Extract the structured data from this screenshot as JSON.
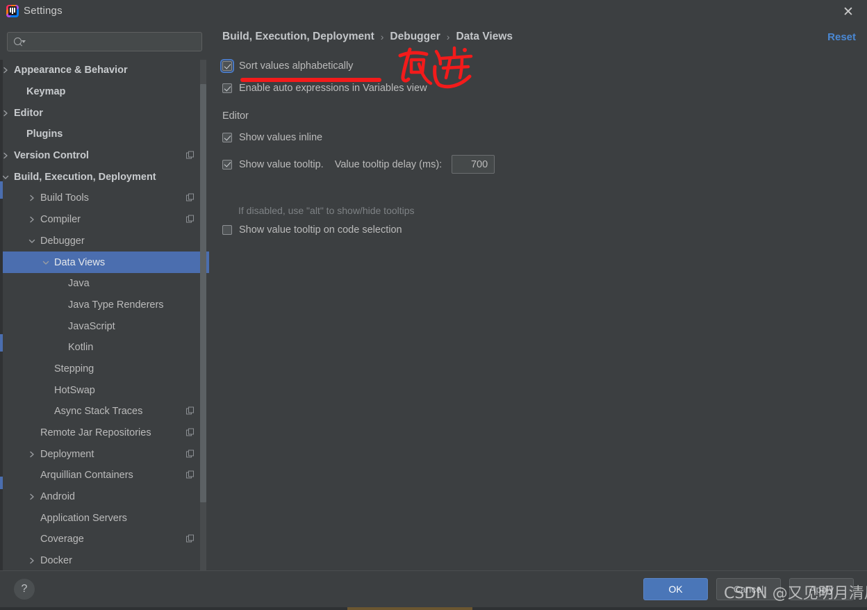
{
  "window": {
    "title": "Settings",
    "logo_icon": "intellij-idea-logo",
    "close_icon": "close-icon"
  },
  "sidebar": {
    "search": {
      "value": "",
      "placeholder": "",
      "icon": "search-icon"
    },
    "items": [
      {
        "label": "Appearance & Behavior",
        "indent": 20,
        "arrow": "right",
        "bold": true,
        "copy": false,
        "selected": false
      },
      {
        "label": "Keymap",
        "indent": 38,
        "arrow": "none",
        "bold": true,
        "copy": false,
        "selected": false
      },
      {
        "label": "Editor",
        "indent": 20,
        "arrow": "right",
        "bold": true,
        "copy": false,
        "selected": false
      },
      {
        "label": "Plugins",
        "indent": 38,
        "arrow": "none",
        "bold": true,
        "copy": false,
        "selected": false
      },
      {
        "label": "Version Control",
        "indent": 20,
        "arrow": "right",
        "bold": true,
        "copy": true,
        "selected": false
      },
      {
        "label": "Build, Execution, Deployment",
        "indent": 20,
        "arrow": "down",
        "bold": true,
        "copy": false,
        "selected": false
      },
      {
        "label": "Build Tools",
        "indent": 58,
        "arrow": "right",
        "bold": false,
        "copy": true,
        "selected": false
      },
      {
        "label": "Compiler",
        "indent": 58,
        "arrow": "right",
        "bold": false,
        "copy": true,
        "selected": false
      },
      {
        "label": "Debugger",
        "indent": 58,
        "arrow": "down",
        "bold": false,
        "copy": false,
        "selected": false
      },
      {
        "label": "Data Views",
        "indent": 78,
        "arrow": "down",
        "bold": false,
        "copy": false,
        "selected": true
      },
      {
        "label": "Java",
        "indent": 98,
        "arrow": "none",
        "bold": false,
        "copy": false,
        "selected": false
      },
      {
        "label": "Java Type Renderers",
        "indent": 98,
        "arrow": "none",
        "bold": false,
        "copy": false,
        "selected": false
      },
      {
        "label": "JavaScript",
        "indent": 98,
        "arrow": "none",
        "bold": false,
        "copy": false,
        "selected": false
      },
      {
        "label": "Kotlin",
        "indent": 98,
        "arrow": "none",
        "bold": false,
        "copy": false,
        "selected": false
      },
      {
        "label": "Stepping",
        "indent": 78,
        "arrow": "none",
        "bold": false,
        "copy": false,
        "selected": false
      },
      {
        "label": "HotSwap",
        "indent": 78,
        "arrow": "none",
        "bold": false,
        "copy": false,
        "selected": false
      },
      {
        "label": "Async Stack Traces",
        "indent": 78,
        "arrow": "none",
        "bold": false,
        "copy": true,
        "selected": false
      },
      {
        "label": "Remote Jar Repositories",
        "indent": 58,
        "arrow": "none",
        "bold": false,
        "copy": true,
        "selected": false
      },
      {
        "label": "Deployment",
        "indent": 58,
        "arrow": "right",
        "bold": false,
        "copy": true,
        "selected": false
      },
      {
        "label": "Arquillian Containers",
        "indent": 58,
        "arrow": "none",
        "bold": false,
        "copy": true,
        "selected": false
      },
      {
        "label": "Android",
        "indent": 58,
        "arrow": "right",
        "bold": false,
        "copy": false,
        "selected": false
      },
      {
        "label": "Application Servers",
        "indent": 58,
        "arrow": "none",
        "bold": false,
        "copy": false,
        "selected": false
      },
      {
        "label": "Coverage",
        "indent": 58,
        "arrow": "none",
        "bold": false,
        "copy": true,
        "selected": false
      },
      {
        "label": "Docker",
        "indent": 58,
        "arrow": "right",
        "bold": false,
        "copy": false,
        "selected": false
      }
    ]
  },
  "content": {
    "breadcrumb": {
      "part1": "Build, Execution, Deployment",
      "sep1": "›",
      "part2": "Debugger",
      "sep2": "›",
      "part3": "Data Views"
    },
    "reset_label": "Reset",
    "options_top": [
      {
        "label": "Sort values alphabetically",
        "checked": true,
        "focused": true
      },
      {
        "label": "Enable auto expressions in Variables view",
        "checked": true,
        "focused": false
      }
    ],
    "editor_section": {
      "title": "Editor",
      "show_values_inline": {
        "label": "Show values inline",
        "checked": true
      },
      "show_value_tooltip": {
        "label": "Show value tooltip.",
        "checked": true
      },
      "delay_label": "Value tooltip delay (ms):",
      "delay_value": "700",
      "hint": "If disabled, use \"alt\" to show/hide tooltips",
      "tooltip_on_selection": {
        "label": "Show value tooltip on code selection",
        "checked": false
      }
    }
  },
  "annotation": {
    "handwriting_text": "勾选",
    "color": "#f31b1b"
  },
  "footer": {
    "help_icon": "?",
    "ok_label": "OK",
    "cancel_label": "Cancel",
    "apply_label": "Apply",
    "watermark": "CSDN @又见明月清风"
  },
  "colors": {
    "background": "#3c3f41",
    "selection": "#4b6eaf",
    "accent_link": "#4a88d4",
    "ok_button": "#4a76b8",
    "annotation_red": "#f31b1b"
  }
}
